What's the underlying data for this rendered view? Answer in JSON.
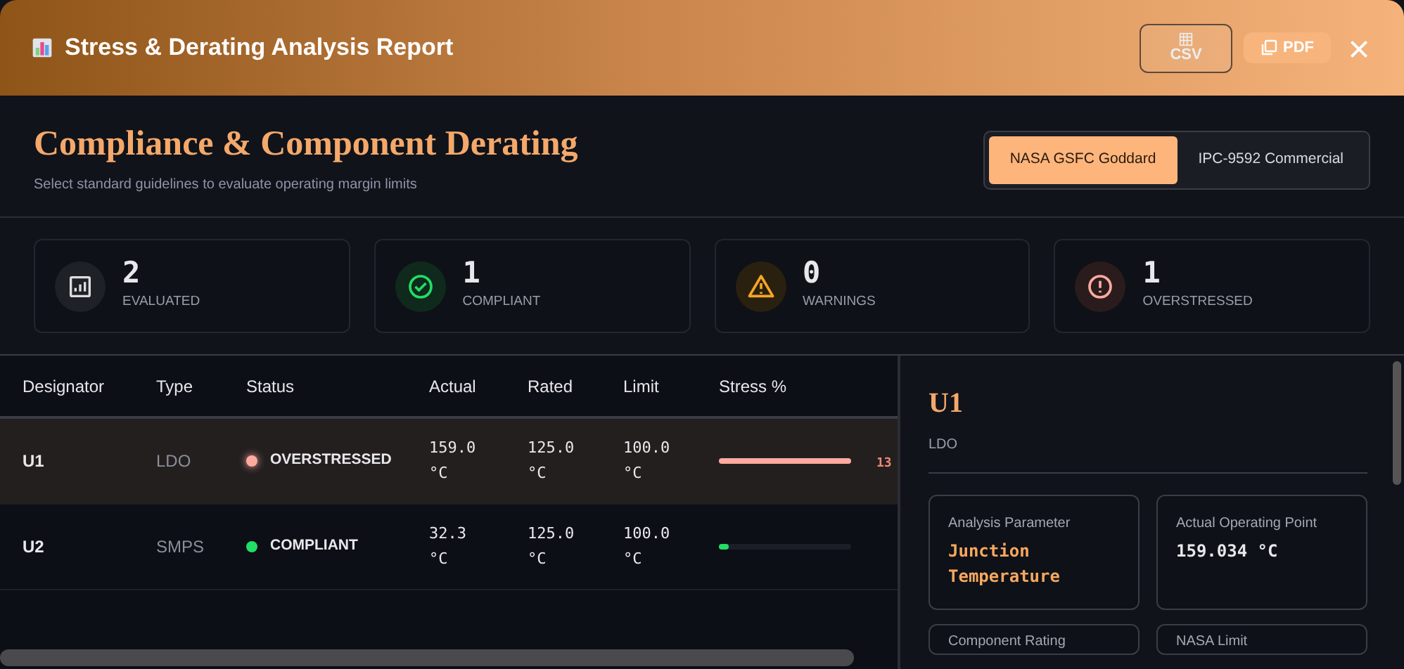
{
  "header": {
    "title": "Stress & Derating Analysis Report",
    "buttons": [
      {
        "kind": "csv",
        "label": "CSV"
      },
      {
        "kind": "pdf",
        "label": "PDF"
      }
    ]
  },
  "intro": {
    "title": "Compliance & Component Derating",
    "subtitle": "Select standard guidelines to evaluate operating margin limits"
  },
  "standards": [
    {
      "label": "NASA GSFC Goddard",
      "selected": true
    },
    {
      "label": "IPC-9592 Commercial",
      "selected": false
    }
  ],
  "stats": [
    {
      "kind": "evaluated",
      "value": "2",
      "label": "EVALUATED"
    },
    {
      "kind": "compliant",
      "value": "1",
      "label": "COMPLIANT"
    },
    {
      "kind": "warning",
      "value": "0",
      "label": "WARNINGS"
    },
    {
      "kind": "overstressed",
      "value": "1",
      "label": "OVERSTRESSED"
    }
  ],
  "table": {
    "columns": [
      "Designator",
      "Type",
      "Status",
      "Actual",
      "Rated",
      "Limit",
      "Stress %"
    ],
    "rows": [
      {
        "designator": "U1",
        "type": "LDO",
        "status": "OVERSTRESSED",
        "color": "#ffaaa0",
        "actual": [
          "159.0",
          "°C"
        ],
        "rated": [
          "125.0",
          "°C"
        ],
        "limit": [
          "100.0",
          "°C"
        ],
        "level": 1,
        "stress": "13",
        "selected": true
      },
      {
        "designator": "U2",
        "type": "SMPS",
        "status": "COMPLIANT",
        "color": "#22dd66",
        "actual": [
          "32.3",
          "°C"
        ],
        "rated": [
          "125.0",
          "°C"
        ],
        "limit": [
          "100.0",
          "°C"
        ],
        "level": 0.07,
        "selected": false
      }
    ]
  },
  "detail": {
    "title": "U1",
    "subtitle": "LDO",
    "cards": [
      {
        "label": "Analysis Parameter",
        "value": "Junction Temperature",
        "kind": "accent"
      },
      {
        "label": "Actual Operating Point",
        "value": "159.034 °C",
        "kind": "plain"
      },
      {
        "label": "Component Rating"
      },
      {
        "label": "NASA Limit"
      }
    ]
  }
}
